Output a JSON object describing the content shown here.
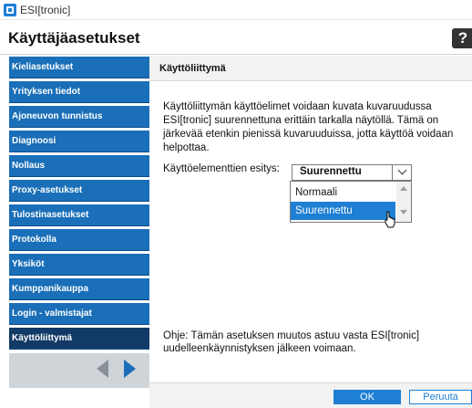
{
  "window": {
    "title": "ESI[tronic]"
  },
  "header": {
    "title": "Käyttäjäasetukset",
    "help_label": "?"
  },
  "sidebar": {
    "items": [
      {
        "label": "Kieliasetukset"
      },
      {
        "label": "Yrityksen tiedot"
      },
      {
        "label": "Ajoneuvon tunnistus"
      },
      {
        "label": "Diagnoosi"
      },
      {
        "label": "Nollaus"
      },
      {
        "label": "Proxy-asetukset"
      },
      {
        "label": "Tulostinasetukset"
      },
      {
        "label": "Protokolla"
      },
      {
        "label": "Yksiköt"
      },
      {
        "label": "Kumppanikauppa"
      },
      {
        "label": "Login - valmistajat"
      },
      {
        "label": "Käyttöliittymä",
        "active": true
      }
    ]
  },
  "content": {
    "section_title": "Käyttöliittymä",
    "description": "Käyttöliittymän käyttöelimet voidaan kuvata kuvaruudussa ESI[tronic] suurennettuna erittäin tarkalla näytöllä. Tämä on järkevää etenkin pienissä kuvaruuduissa, jotta käyttöä voidaan helpottaa.",
    "setting": {
      "label": "Käyttöelementtien esitys:",
      "selected": "Suurennettu",
      "options": [
        "Normaali",
        "Suurennettu"
      ]
    },
    "note": "Ohje: Tämän asetuksen muutos astuu vasta ESI[tronic] uudelleenkäynnistyksen jälkeen voimaan."
  },
  "footer": {
    "ok_label": "OK",
    "cancel_label": "Peruuta"
  },
  "colors": {
    "nav_blue": "#1a6fb8",
    "nav_active": "#123a66",
    "accent": "#1e7fd4"
  }
}
